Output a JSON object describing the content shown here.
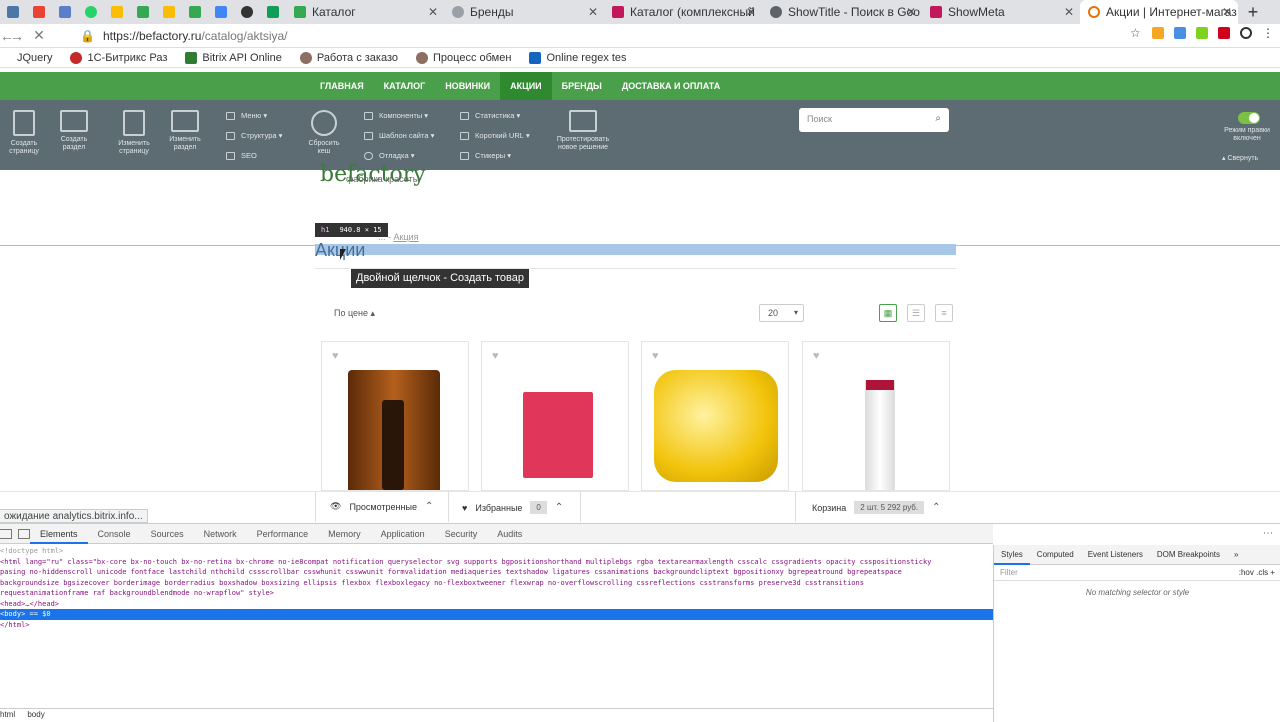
{
  "browser": {
    "tabs": [
      {
        "label": "Каталог",
        "color": "#35a853"
      },
      {
        "label": "Бренды",
        "color": "#9aa0a6"
      },
      {
        "label": "Каталог (комплексный",
        "color": "#c2185b"
      },
      {
        "label": "ShowTitle - Поиск в Goo",
        "color": "#5f6368"
      },
      {
        "label": "ShowMeta",
        "color": "#c2185b"
      },
      {
        "label": "Акции | Интернет-магаз",
        "color": "#e8710a"
      }
    ],
    "url_host": "https://befactory.ru",
    "url_path": "/catalog/aktsiya/",
    "bookmarks": [
      {
        "label": "JQuery",
        "color": "#ffffff"
      },
      {
        "label": "1С-Битрикс Раз",
        "color": "#c62828"
      },
      {
        "label": "Bitrix API Online",
        "color": "#2e7d32"
      },
      {
        "label": "Работа с заказо",
        "color": "#8d6e63"
      },
      {
        "label": "Процесс обмен",
        "color": "#8d6e63"
      },
      {
        "label": "Online regex tes",
        "color": "#1565c0"
      }
    ]
  },
  "site_nav": {
    "items": [
      {
        "label": "ГЛАВНАЯ"
      },
      {
        "label": "КАТАЛОГ"
      },
      {
        "label": "НОВИНКИ"
      },
      {
        "label": "АКЦИИ"
      },
      {
        "label": "БРЕНДЫ"
      },
      {
        "label": "ДОСТАВКА И ОПЛАТА"
      }
    ],
    "active": "АКЦИИ"
  },
  "admin_panel": {
    "big_buttons": [
      {
        "label": "Создать страницу",
        "name": "create-page-button"
      },
      {
        "label": "Создать раздел",
        "name": "create-section-button"
      },
      {
        "label": "Изменить страницу",
        "name": "edit-page-button"
      },
      {
        "label": "Изменить раздел",
        "name": "edit-section-button"
      },
      {
        "label": "Сбросить кеш",
        "name": "reset-cache-button"
      }
    ],
    "col1": [
      "Меню",
      "Структура",
      "SEO"
    ],
    "col2": [
      "Компоненты",
      "Шаблон сайта",
      "Отладка"
    ],
    "col3": [
      "Статистика",
      "Короткий URL",
      "Стикеры"
    ],
    "test_label": "Протестировать новое решение",
    "search_placeholder": "Поиск",
    "edit_mode": "Режим правки включен",
    "collapse": "Свернуть"
  },
  "page": {
    "logo": "befactory",
    "logo_sub": "фабрика красоты",
    "breadcrumb": [
      "...",
      "Акция"
    ],
    "title": "Акции",
    "element_label_tag": "h1",
    "element_label_size": "940.8 × 15",
    "tooltip": "Двойной щелчок - Создать товар",
    "sort_label": "По цене",
    "per_page": "20"
  },
  "products": [
    {
      "name": "bag-product",
      "color": "#7a3a10"
    },
    {
      "name": "totalresults-product",
      "color": "#e0365a"
    },
    {
      "name": "serie-expert-product",
      "color": "#f2c40c"
    },
    {
      "name": "bottle-product",
      "color": "#f0f0f0"
    }
  ],
  "bottom_bar": {
    "viewed": "Просмотренные",
    "favorites": "Избранные",
    "favorites_count": "0",
    "cart": "Корзина",
    "cart_summary": "2 шт.  5 292 руб."
  },
  "status_text": "ожидание analytics.bitrix.info...",
  "devtools": {
    "tabs": [
      "Elements",
      "Console",
      "Sources",
      "Network",
      "Performance",
      "Memory",
      "Application",
      "Security",
      "Audits"
    ],
    "active_tab": "Elements",
    "code_lines": [
      "<!doctype html>",
      "<html lang=\"ru\" class=\"bx-core bx-no-touch bx-no-retina bx-chrome no-ie8compat notification queryselector svg supports bgpositionshorthand multiplebgs rgba textarearmaxlength csscalc cssgradients opacity csspositionsticky",
      "pasing no-hiddenscroll unicode fontface lastchild nthchild cssscrollbar csswhunit csswwunit formvalidation mediaqueries textshadow ligatures cssanimations backgroundcliptext bgpositionxy bgrepeatround bgrepeatspace",
      "backgroundsize bgsizecover borderimage borderradius boxshadow boxsizing ellipsis flexbox flexboxlegacy no-flexboxtweener flexwrap no-overflowscrolling cssreflections csstransforms preserve3d csstransitions",
      "requestanimationframe raf backgroundblendmode no-wrapflow\" style>",
      "<head>…</head>",
      "<body> == $0",
      "</html>"
    ],
    "side_tabs": [
      "Styles",
      "Computed",
      "Event Listeners",
      "DOM Breakpoints"
    ],
    "filter_placeholder": "Filter",
    "filter_right": ":hov  .cls  +",
    "no_match": "No matching selector or style",
    "crumbs": [
      "html",
      "body"
    ]
  }
}
